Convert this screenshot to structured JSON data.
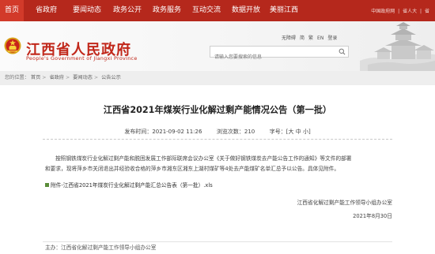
{
  "nav": {
    "items": [
      "首页",
      "省政府",
      "要闻动态",
      "政务公开",
      "政务服务",
      "互动交流",
      "数据开放",
      "美丽江西"
    ]
  },
  "topright": {
    "home": "中国政府网",
    "sep": "|",
    "personal": "省人大",
    "more": "省"
  },
  "header": {
    "title": "江西省人民政府",
    "subtitle": "People's Government of Jiangxi Province",
    "links": [
      "无障碍",
      "简",
      "繁",
      "EN",
      "登录"
    ],
    "search_placeholder": "请输入您要搜索的信息"
  },
  "breadcrumb": {
    "label": "您的位置：",
    "items": [
      "首页",
      "省政府",
      "要闻动态",
      "公告公示"
    ]
  },
  "article": {
    "title": "江西省2021年煤炭行业化解过剩产能情况公告（第一批）",
    "date_label": "发布时间：",
    "date": "2021-09-02 11:26",
    "views_label": "浏览次数：",
    "views": "210",
    "font_label": "字号：",
    "font_large": "大",
    "font_medium": "中",
    "font_small": "小",
    "para1_line1": "按照钢铁煤炭行业化解过剩产能和脱困发展工作部际联席会议办公室《关于做好钢铁煤炭去产能公告工作的通知》等文件的部署",
    "para1_line2": "和要求，现将萍乡市关闭退出并经验收合格的萍乡市湘东区湘东上湖村煤矿等4处去产能煤矿名单汇总予以公告。具体见附件。",
    "attachment": "附件-江西省2021年煤炭行业化解过剩产能汇总公告表（第一批）.xls",
    "signature": "江西省化解过剩产能工作领导小组办公室",
    "sign_date": "2021年8月30日",
    "footer_source": "主办：江西省化解过剩产能工作领导小组办公室"
  },
  "colors": {
    "nav_bg": "#b5281c",
    "brand_red": "#c1271a",
    "breadcrumb_bg": "#eeeeee"
  }
}
